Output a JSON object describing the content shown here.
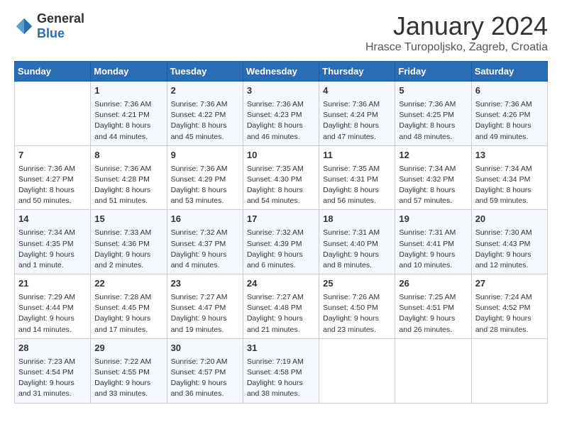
{
  "header": {
    "logo_general": "General",
    "logo_blue": "Blue",
    "month_title": "January 2024",
    "location": "Hrasce Turopoljsko, Zagreb, Croatia"
  },
  "weekdays": [
    "Sunday",
    "Monday",
    "Tuesday",
    "Wednesday",
    "Thursday",
    "Friday",
    "Saturday"
  ],
  "weeks": [
    [
      {
        "day": "",
        "sunrise": "",
        "sunset": "",
        "daylight": ""
      },
      {
        "day": "1",
        "sunrise": "Sunrise: 7:36 AM",
        "sunset": "Sunset: 4:21 PM",
        "daylight": "Daylight: 8 hours and 44 minutes."
      },
      {
        "day": "2",
        "sunrise": "Sunrise: 7:36 AM",
        "sunset": "Sunset: 4:22 PM",
        "daylight": "Daylight: 8 hours and 45 minutes."
      },
      {
        "day": "3",
        "sunrise": "Sunrise: 7:36 AM",
        "sunset": "Sunset: 4:23 PM",
        "daylight": "Daylight: 8 hours and 46 minutes."
      },
      {
        "day": "4",
        "sunrise": "Sunrise: 7:36 AM",
        "sunset": "Sunset: 4:24 PM",
        "daylight": "Daylight: 8 hours and 47 minutes."
      },
      {
        "day": "5",
        "sunrise": "Sunrise: 7:36 AM",
        "sunset": "Sunset: 4:25 PM",
        "daylight": "Daylight: 8 hours and 48 minutes."
      },
      {
        "day": "6",
        "sunrise": "Sunrise: 7:36 AM",
        "sunset": "Sunset: 4:26 PM",
        "daylight": "Daylight: 8 hours and 49 minutes."
      }
    ],
    [
      {
        "day": "7",
        "sunrise": "Sunrise: 7:36 AM",
        "sunset": "Sunset: 4:27 PM",
        "daylight": "Daylight: 8 hours and 50 minutes."
      },
      {
        "day": "8",
        "sunrise": "Sunrise: 7:36 AM",
        "sunset": "Sunset: 4:28 PM",
        "daylight": "Daylight: 8 hours and 51 minutes."
      },
      {
        "day": "9",
        "sunrise": "Sunrise: 7:36 AM",
        "sunset": "Sunset: 4:29 PM",
        "daylight": "Daylight: 8 hours and 53 minutes."
      },
      {
        "day": "10",
        "sunrise": "Sunrise: 7:35 AM",
        "sunset": "Sunset: 4:30 PM",
        "daylight": "Daylight: 8 hours and 54 minutes."
      },
      {
        "day": "11",
        "sunrise": "Sunrise: 7:35 AM",
        "sunset": "Sunset: 4:31 PM",
        "daylight": "Daylight: 8 hours and 56 minutes."
      },
      {
        "day": "12",
        "sunrise": "Sunrise: 7:34 AM",
        "sunset": "Sunset: 4:32 PM",
        "daylight": "Daylight: 8 hours and 57 minutes."
      },
      {
        "day": "13",
        "sunrise": "Sunrise: 7:34 AM",
        "sunset": "Sunset: 4:34 PM",
        "daylight": "Daylight: 8 hours and 59 minutes."
      }
    ],
    [
      {
        "day": "14",
        "sunrise": "Sunrise: 7:34 AM",
        "sunset": "Sunset: 4:35 PM",
        "daylight": "Daylight: 9 hours and 1 minute."
      },
      {
        "day": "15",
        "sunrise": "Sunrise: 7:33 AM",
        "sunset": "Sunset: 4:36 PM",
        "daylight": "Daylight: 9 hours and 2 minutes."
      },
      {
        "day": "16",
        "sunrise": "Sunrise: 7:32 AM",
        "sunset": "Sunset: 4:37 PM",
        "daylight": "Daylight: 9 hours and 4 minutes."
      },
      {
        "day": "17",
        "sunrise": "Sunrise: 7:32 AM",
        "sunset": "Sunset: 4:39 PM",
        "daylight": "Daylight: 9 hours and 6 minutes."
      },
      {
        "day": "18",
        "sunrise": "Sunrise: 7:31 AM",
        "sunset": "Sunset: 4:40 PM",
        "daylight": "Daylight: 9 hours and 8 minutes."
      },
      {
        "day": "19",
        "sunrise": "Sunrise: 7:31 AM",
        "sunset": "Sunset: 4:41 PM",
        "daylight": "Daylight: 9 hours and 10 minutes."
      },
      {
        "day": "20",
        "sunrise": "Sunrise: 7:30 AM",
        "sunset": "Sunset: 4:43 PM",
        "daylight": "Daylight: 9 hours and 12 minutes."
      }
    ],
    [
      {
        "day": "21",
        "sunrise": "Sunrise: 7:29 AM",
        "sunset": "Sunset: 4:44 PM",
        "daylight": "Daylight: 9 hours and 14 minutes."
      },
      {
        "day": "22",
        "sunrise": "Sunrise: 7:28 AM",
        "sunset": "Sunset: 4:45 PM",
        "daylight": "Daylight: 9 hours and 17 minutes."
      },
      {
        "day": "23",
        "sunrise": "Sunrise: 7:27 AM",
        "sunset": "Sunset: 4:47 PM",
        "daylight": "Daylight: 9 hours and 19 minutes."
      },
      {
        "day": "24",
        "sunrise": "Sunrise: 7:27 AM",
        "sunset": "Sunset: 4:48 PM",
        "daylight": "Daylight: 9 hours and 21 minutes."
      },
      {
        "day": "25",
        "sunrise": "Sunrise: 7:26 AM",
        "sunset": "Sunset: 4:50 PM",
        "daylight": "Daylight: 9 hours and 23 minutes."
      },
      {
        "day": "26",
        "sunrise": "Sunrise: 7:25 AM",
        "sunset": "Sunset: 4:51 PM",
        "daylight": "Daylight: 9 hours and 26 minutes."
      },
      {
        "day": "27",
        "sunrise": "Sunrise: 7:24 AM",
        "sunset": "Sunset: 4:52 PM",
        "daylight": "Daylight: 9 hours and 28 minutes."
      }
    ],
    [
      {
        "day": "28",
        "sunrise": "Sunrise: 7:23 AM",
        "sunset": "Sunset: 4:54 PM",
        "daylight": "Daylight: 9 hours and 31 minutes."
      },
      {
        "day": "29",
        "sunrise": "Sunrise: 7:22 AM",
        "sunset": "Sunset: 4:55 PM",
        "daylight": "Daylight: 9 hours and 33 minutes."
      },
      {
        "day": "30",
        "sunrise": "Sunrise: 7:20 AM",
        "sunset": "Sunset: 4:57 PM",
        "daylight": "Daylight: 9 hours and 36 minutes."
      },
      {
        "day": "31",
        "sunrise": "Sunrise: 7:19 AM",
        "sunset": "Sunset: 4:58 PM",
        "daylight": "Daylight: 9 hours and 38 minutes."
      },
      {
        "day": "",
        "sunrise": "",
        "sunset": "",
        "daylight": ""
      },
      {
        "day": "",
        "sunrise": "",
        "sunset": "",
        "daylight": ""
      },
      {
        "day": "",
        "sunrise": "",
        "sunset": "",
        "daylight": ""
      }
    ]
  ]
}
